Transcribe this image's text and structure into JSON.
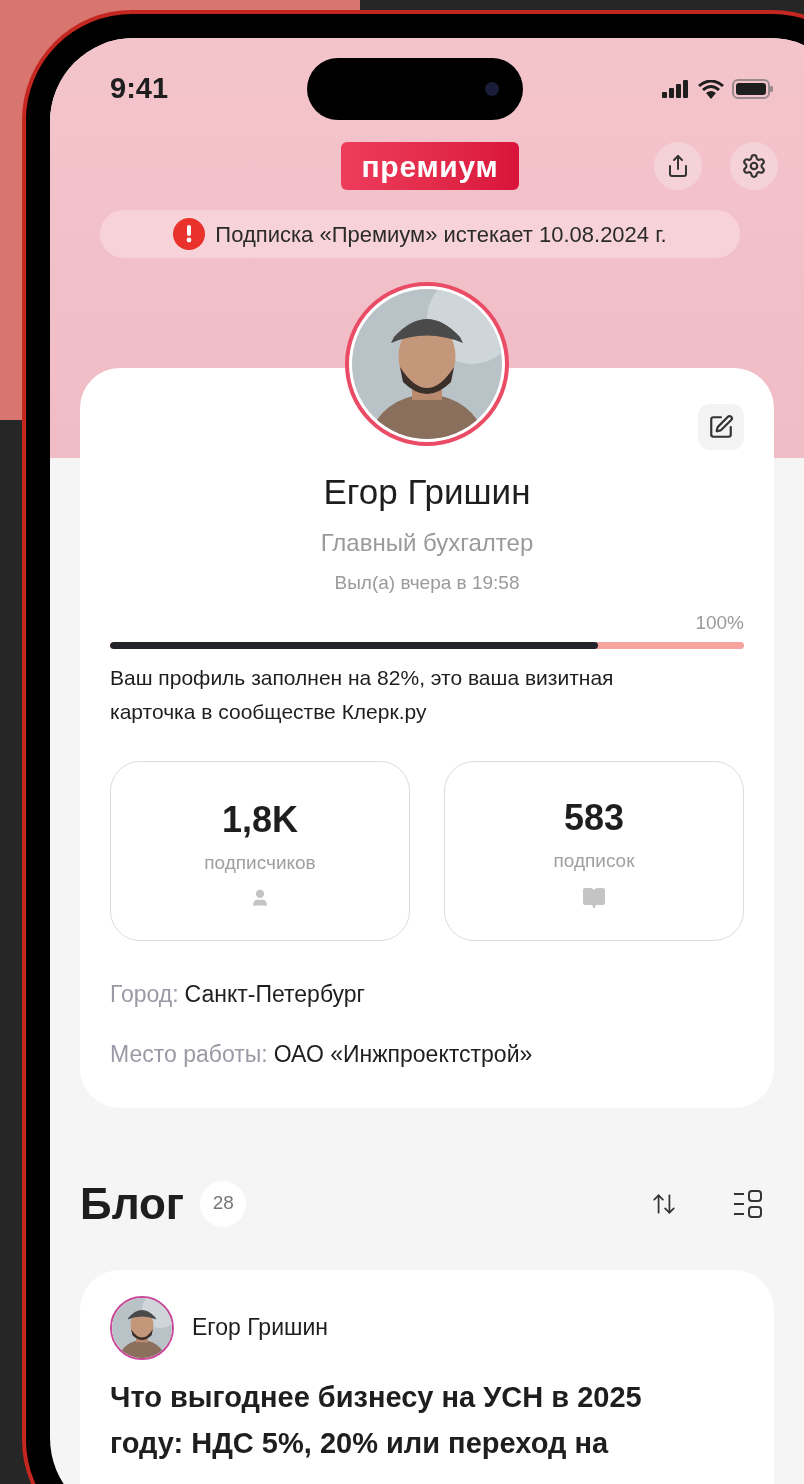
{
  "status_bar": {
    "time": "9:41"
  },
  "header": {
    "badge": "премиум",
    "alert": "Подписка «Премиум» истекает 10.08.2024 г."
  },
  "profile": {
    "name": "Егор Гришин",
    "position": "Главный бухгалтер",
    "last_seen": "Выл(а) вчера в 19:58",
    "progress": {
      "label": "100%",
      "level": 0.77
    },
    "description": "Ваш профиль заполнен на 82%, это ваша визитная карточка в сообществе Клерк.ру",
    "stats": [
      {
        "kind": "followers",
        "value": "1,8K",
        "label": "подписчиков"
      },
      {
        "kind": "subscriptions",
        "value": "583",
        "label": "подписок"
      }
    ],
    "details": [
      {
        "label": "Город:",
        "value": "Санкт-Петербург"
      },
      {
        "label": "Место работы:",
        "value": "ОАО «Инжпроектстрой»"
      }
    ]
  },
  "blog": {
    "title": "Блог",
    "count": "28",
    "posts": [
      {
        "author": "Егор Гришин",
        "title": "Что выгоднее бизнесу на УСН в 2025 году: НДС 5%, 20% или переход на"
      }
    ]
  }
}
